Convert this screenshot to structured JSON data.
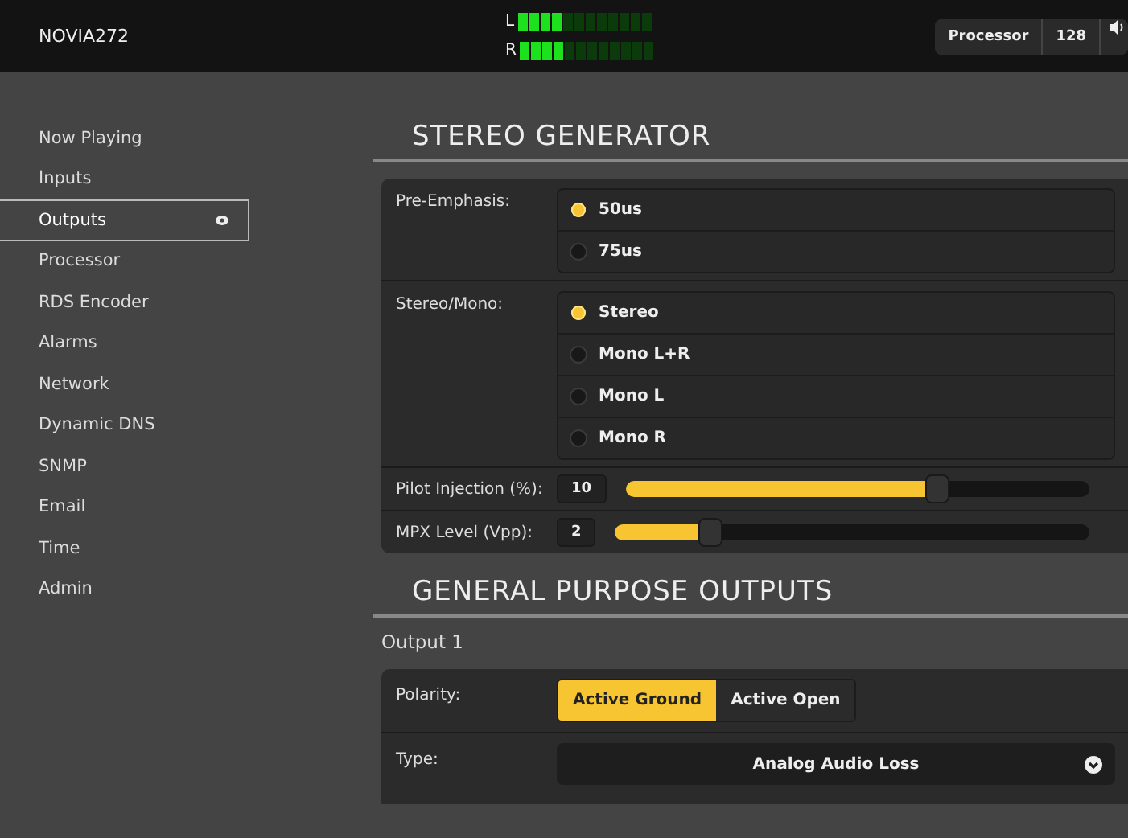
{
  "header": {
    "title": "NOVIA272",
    "meters": [
      {
        "label": "L",
        "level": 0.33
      },
      {
        "label": "R",
        "level": 0.33
      }
    ],
    "buttons": [
      "Processor",
      "128"
    ]
  },
  "sidebar": {
    "items": [
      {
        "label": "Now Playing",
        "selected": false
      },
      {
        "label": "Inputs",
        "selected": false
      },
      {
        "label": "Outputs",
        "selected": true
      },
      {
        "label": "Processor",
        "selected": false
      },
      {
        "label": "RDS Encoder",
        "selected": false
      },
      {
        "label": "Alarms",
        "selected": false
      },
      {
        "label": "Network",
        "selected": false
      },
      {
        "label": "Dynamic DNS",
        "selected": false
      },
      {
        "label": "SNMP",
        "selected": false
      },
      {
        "label": "Email",
        "selected": false
      },
      {
        "label": "Time",
        "selected": false
      },
      {
        "label": "Admin",
        "selected": false
      }
    ]
  },
  "stereo_generator": {
    "heading": "STEREO GENERATOR",
    "rows": [
      {
        "kind": "radio",
        "label": "Pre-Emphasis:",
        "options": [
          {
            "label": "50us",
            "selected": true
          },
          {
            "label": "75us",
            "selected": false
          }
        ]
      },
      {
        "kind": "radio",
        "label": "Stereo/Mono:",
        "options": [
          {
            "label": "Stereo",
            "selected": true
          },
          {
            "label": "Mono L+R",
            "selected": false
          },
          {
            "label": "Mono L",
            "selected": false
          },
          {
            "label": "Mono R",
            "selected": false
          }
        ]
      },
      {
        "kind": "slider",
        "label": "Pilot Injection (%):",
        "value": "10",
        "level": 0.67
      },
      {
        "kind": "slider",
        "label": "MPX Level (Vpp):",
        "value": "2",
        "level": 0.2
      }
    ]
  },
  "general_purpose_outputs": {
    "heading": "GENERAL PURPOSE OUTPUTS",
    "subheading": "Output 1",
    "rows": [
      {
        "kind": "segmented",
        "label": "Polarity:",
        "options": [
          {
            "label": "Active Ground",
            "selected": true
          },
          {
            "label": "Active Open",
            "selected": false
          }
        ]
      },
      {
        "kind": "select",
        "label": "Type:",
        "value": "Analog Audio Loss"
      }
    ]
  }
}
